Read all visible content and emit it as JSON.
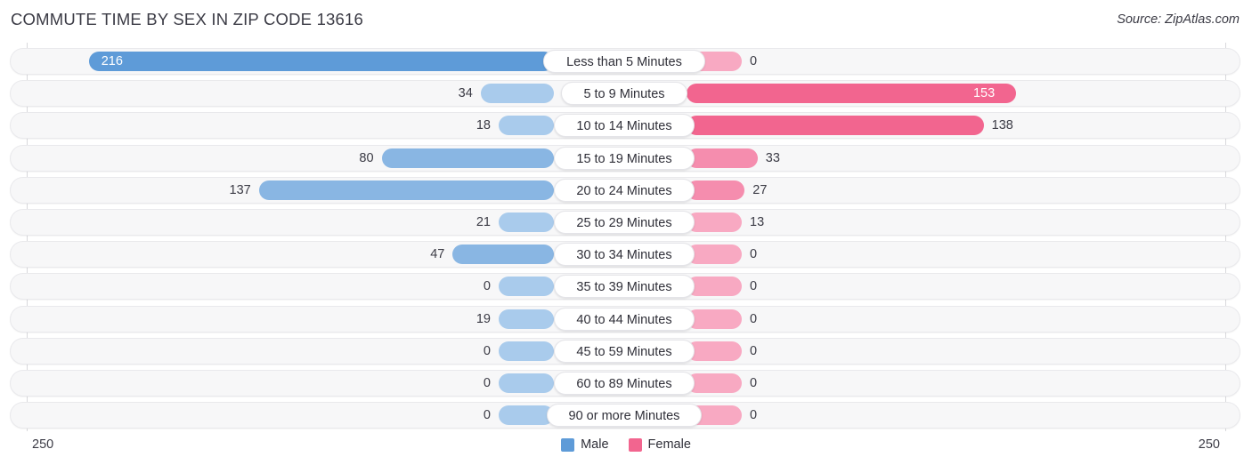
{
  "header": {
    "title": "COMMUTE TIME BY SEX IN ZIP CODE 13616",
    "source": "Source: ZipAtlas.com"
  },
  "axis": {
    "left_label": "250",
    "right_label": "250",
    "max": 250
  },
  "legend": {
    "items": [
      {
        "label": "Male",
        "color": "#5e9bd8"
      },
      {
        "label": "Female",
        "color": "#f2658f"
      }
    ]
  },
  "colors": {
    "male_strong": "#5e9bd8",
    "male_mid": "#89b6e3",
    "male_light": "#a9cbec",
    "female_strong": "#f2658f",
    "female_mid": "#f58dae",
    "female_light": "#f8a9c2",
    "track": "#f7f7f8",
    "gridline": "#d8d8dc",
    "text": "#3b3b45"
  },
  "chart_data": {
    "type": "bar",
    "subtype": "diverging-bidirectional",
    "title": "COMMUTE TIME BY SEX IN ZIP CODE 13616",
    "xlabel": "",
    "ylabel": "",
    "xlim": [
      250,
      250
    ],
    "grid": true,
    "legend_position": "bottom-center",
    "categories": [
      "Less than 5 Minutes",
      "5 to 9 Minutes",
      "10 to 14 Minutes",
      "15 to 19 Minutes",
      "20 to 24 Minutes",
      "25 to 29 Minutes",
      "30 to 34 Minutes",
      "35 to 39 Minutes",
      "40 to 44 Minutes",
      "45 to 59 Minutes",
      "60 to 89 Minutes",
      "90 or more Minutes"
    ],
    "series": [
      {
        "name": "Male",
        "direction": "left",
        "values": [
          216,
          34,
          18,
          80,
          137,
          21,
          47,
          0,
          19,
          0,
          0,
          0
        ]
      },
      {
        "name": "Female",
        "direction": "right",
        "values": [
          0,
          153,
          138,
          33,
          27,
          13,
          0,
          0,
          0,
          0,
          0,
          0
        ]
      }
    ]
  },
  "rows": [
    {
      "label": "Less than 5 Minutes",
      "male": "216",
      "female": "0"
    },
    {
      "label": "5 to 9 Minutes",
      "male": "34",
      "female": "153"
    },
    {
      "label": "10 to 14 Minutes",
      "male": "18",
      "female": "138"
    },
    {
      "label": "15 to 19 Minutes",
      "male": "80",
      "female": "33"
    },
    {
      "label": "20 to 24 Minutes",
      "male": "137",
      "female": "27"
    },
    {
      "label": "25 to 29 Minutes",
      "male": "21",
      "female": "13"
    },
    {
      "label": "30 to 34 Minutes",
      "male": "47",
      "female": "0"
    },
    {
      "label": "35 to 39 Minutes",
      "male": "0",
      "female": "0"
    },
    {
      "label": "40 to 44 Minutes",
      "male": "19",
      "female": "0"
    },
    {
      "label": "45 to 59 Minutes",
      "male": "0",
      "female": "0"
    },
    {
      "label": "60 to 89 Minutes",
      "male": "0",
      "female": "0"
    },
    {
      "label": "90 or more Minutes",
      "male": "0",
      "female": "0"
    }
  ]
}
